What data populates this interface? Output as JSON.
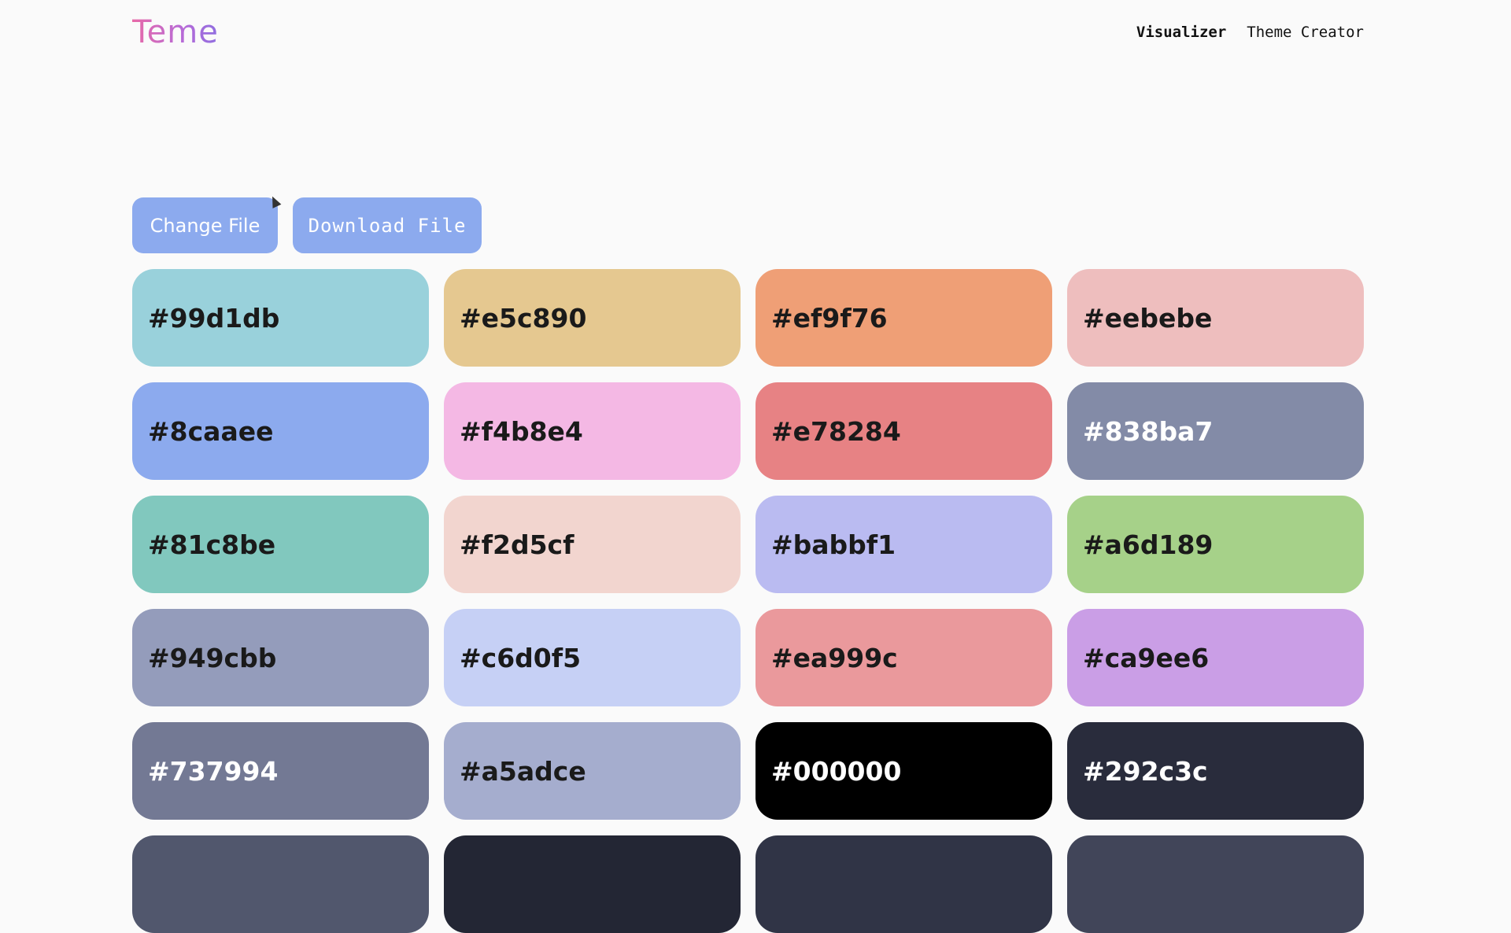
{
  "header": {
    "logo": "Teme",
    "nav": [
      {
        "label": "Visualizer"
      },
      {
        "label": "Theme Creator"
      }
    ]
  },
  "actions": {
    "change_label": "Change File",
    "download_label": "Download File",
    "button_color": "#8caaee"
  },
  "swatches": [
    {
      "hex": "#99d1db",
      "text_color": "#1a1a1a"
    },
    {
      "hex": "#e5c890",
      "text_color": "#1a1a1a"
    },
    {
      "hex": "#ef9f76",
      "text_color": "#1a1a1a"
    },
    {
      "hex": "#eebebe",
      "text_color": "#1a1a1a"
    },
    {
      "hex": "#8caaee",
      "text_color": "#1a1a1a"
    },
    {
      "hex": "#f4b8e4",
      "text_color": "#1a1a1a"
    },
    {
      "hex": "#e78284",
      "text_color": "#1a1a1a"
    },
    {
      "hex": "#838ba7",
      "text_color": "#ffffff"
    },
    {
      "hex": "#81c8be",
      "text_color": "#1a1a1a"
    },
    {
      "hex": "#f2d5cf",
      "text_color": "#1a1a1a"
    },
    {
      "hex": "#babbf1",
      "text_color": "#1a1a1a"
    },
    {
      "hex": "#a6d189",
      "text_color": "#1a1a1a"
    },
    {
      "hex": "#949cbb",
      "text_color": "#1a1a1a"
    },
    {
      "hex": "#c6d0f5",
      "text_color": "#1a1a1a"
    },
    {
      "hex": "#ea999c",
      "text_color": "#1a1a1a"
    },
    {
      "hex": "#ca9ee6",
      "text_color": "#1a1a1a"
    },
    {
      "hex": "#737994",
      "text_color": "#ffffff"
    },
    {
      "hex": "#a5adce",
      "text_color": "#1a1a1a"
    },
    {
      "hex": "#000000",
      "text_color": "#ffffff"
    },
    {
      "hex": "#292c3c",
      "text_color": "#ffffff"
    }
  ],
  "partial_row_colors": [
    "#51576d",
    "#232634",
    "#303446",
    "#414559"
  ]
}
